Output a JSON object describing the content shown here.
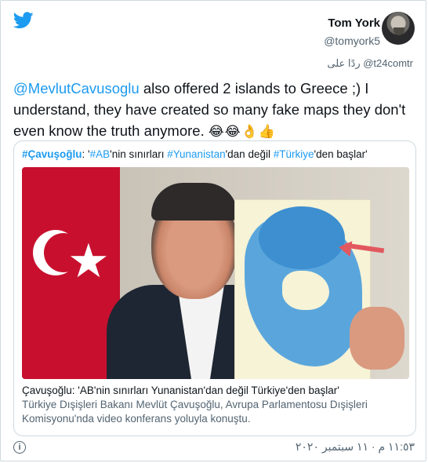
{
  "author": {
    "name": "Tom York",
    "handle": "@tomyork5"
  },
  "reply_line": {
    "text": "ردًا على @t24comtr"
  },
  "tweet": {
    "mention": "@MevlutCavusoglu",
    "body": " also offered 2 islands to Greece ;) I understand, they have created so many fake maps they don't even know the truth anymore. ",
    "emojis": "😂😂👌👍"
  },
  "link_card": {
    "header_tag1": "#Çavuşoğlu",
    "header_part2": ": '",
    "header_tag2": "#AB",
    "header_part3": "'nin sınırları ",
    "header_tag3": "#Yunanistan",
    "header_part4": "'dan değil ",
    "header_tag4": "#Türkiye",
    "header_part5": "'den başlar'",
    "title": "Çavuşoğlu: 'AB'nin sınırları Yunanistan'dan değil Türkiye'den başlar'",
    "description": "Türkiye Dışişleri Bakanı Mevlüt Çavuşoğlu, Avrupa Parlamentosu Dışişleri Komisyonu'nda video konferans yoluyla konuştu."
  },
  "footer": {
    "timestamp": "١١:٥٣ م · ١١ سبتمبر ٢٠٢٠",
    "info_icon_glyph": "i"
  },
  "colors": {
    "accent": "#1d9bf0",
    "text": "#0f1419",
    "secondary": "#536471"
  }
}
